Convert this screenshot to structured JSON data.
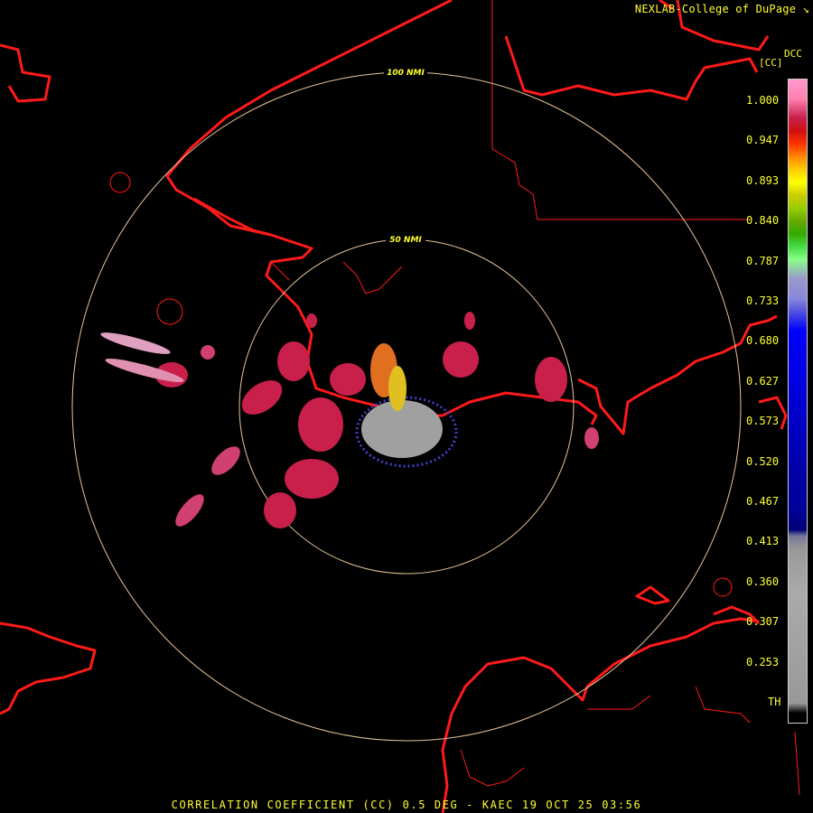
{
  "credit": {
    "text": "NEXLAB-College of DuPage",
    "icon": "arrow-icon"
  },
  "legend": {
    "product": "DCC",
    "unit": "[CC]",
    "ticks": [
      "1.000",
      "0.947",
      "0.893",
      "0.840",
      "0.787",
      "0.733",
      "0.680",
      "0.627",
      "0.573",
      "0.520",
      "0.467",
      "0.413",
      "0.360",
      "0.307",
      "0.253",
      "TH"
    ]
  },
  "rings": [
    {
      "label": "100 NMI",
      "range_nmi": 100
    },
    {
      "label": "50 NMI",
      "range_nmi": 50
    }
  ],
  "caption": "CORRELATION COEFFICIENT (CC) 0.5 DEG - KAEC 19 OCT 25 03:56",
  "colors": {
    "boundary": "#ff1a1a",
    "ring": "#e8c49a",
    "text": "#ffff33",
    "high_cc": "#c8204a",
    "low_cc": "#a0a0a0"
  }
}
